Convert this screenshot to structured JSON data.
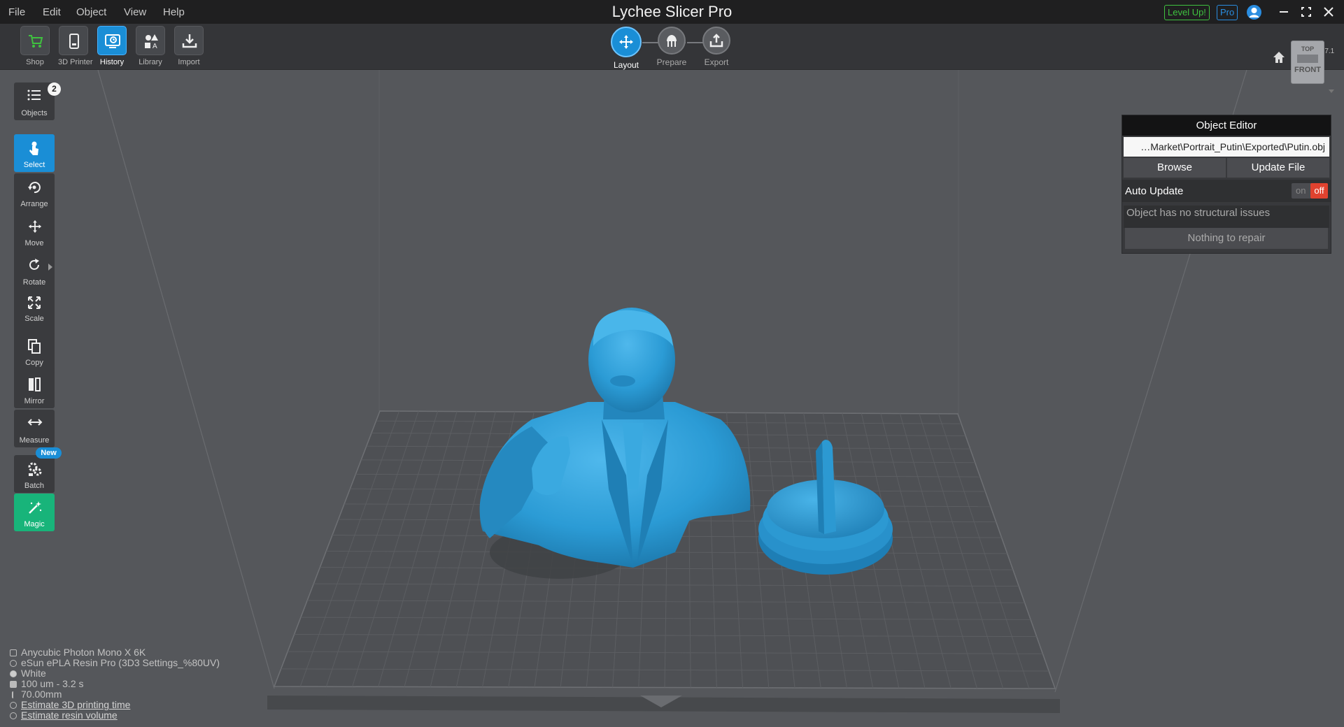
{
  "app": {
    "title": "Lychee Slicer Pro",
    "version": "3.7.1"
  },
  "menu": [
    "File",
    "Edit",
    "Object",
    "View",
    "Help"
  ],
  "header_badges": {
    "level_up": "Level Up!",
    "pro": "Pro"
  },
  "toolbar": {
    "tools": [
      {
        "label": "Shop",
        "icon": "cart-icon"
      },
      {
        "label": "3D Printer",
        "icon": "printer-icon"
      },
      {
        "label": "History",
        "icon": "history-icon",
        "active": true
      },
      {
        "label": "Library",
        "icon": "library-icon"
      },
      {
        "label": "Import",
        "icon": "import-icon"
      }
    ],
    "steps": [
      {
        "label": "Layout",
        "icon": "move-icon",
        "active": true
      },
      {
        "label": "Prepare",
        "icon": "supports-icon"
      },
      {
        "label": "Export",
        "icon": "export-icon"
      }
    ]
  },
  "viewcube": {
    "top": "TOP",
    "front": "FRONT"
  },
  "sidebar": {
    "objects": {
      "label": "Objects",
      "count": "2"
    },
    "items": [
      {
        "label": "Select",
        "icon": "pointer-icon",
        "active": true
      },
      {
        "label": "Arrange",
        "icon": "arrange-icon"
      },
      {
        "label": "Move",
        "icon": "move-icon"
      },
      {
        "label": "Rotate",
        "icon": "rotate-icon"
      },
      {
        "label": "Scale",
        "icon": "scale-icon"
      },
      {
        "label": "Copy",
        "icon": "copy-icon"
      },
      {
        "label": "Mirror",
        "icon": "mirror-icon"
      },
      {
        "label": "Measure",
        "icon": "measure-icon"
      },
      {
        "label": "Batch",
        "icon": "batch-icon",
        "badge": "New"
      },
      {
        "label": "Magic",
        "icon": "magic-icon"
      }
    ]
  },
  "object_editor": {
    "title": "Object Editor",
    "file_path": "…Market\\Portrait_Putin\\Exported\\Putin.obj",
    "browse_label": "Browse",
    "update_label": "Update File",
    "auto_update_label": "Auto Update",
    "toggle_on": "on",
    "toggle_off": "off",
    "auto_update": "off",
    "status": "Object has no structural issues",
    "repair_label": "Nothing to repair"
  },
  "printer_info": {
    "printer": "Anycubic Photon Mono X 6K",
    "resin": "eSun ePLA Resin Pro (3D3 Settings_%80UV)",
    "color": "White",
    "layer": "100 um - 3.2 s",
    "height": "70.00mm",
    "estimate_time": "Estimate 3D printing time",
    "estimate_volume": "Estimate resin volume"
  },
  "colors": {
    "accent": "#1a8ed6",
    "model": "#2f9fd6",
    "magic": "#18b47a",
    "toggle_off": "#e0422f",
    "level_up": "#3fc23f"
  }
}
